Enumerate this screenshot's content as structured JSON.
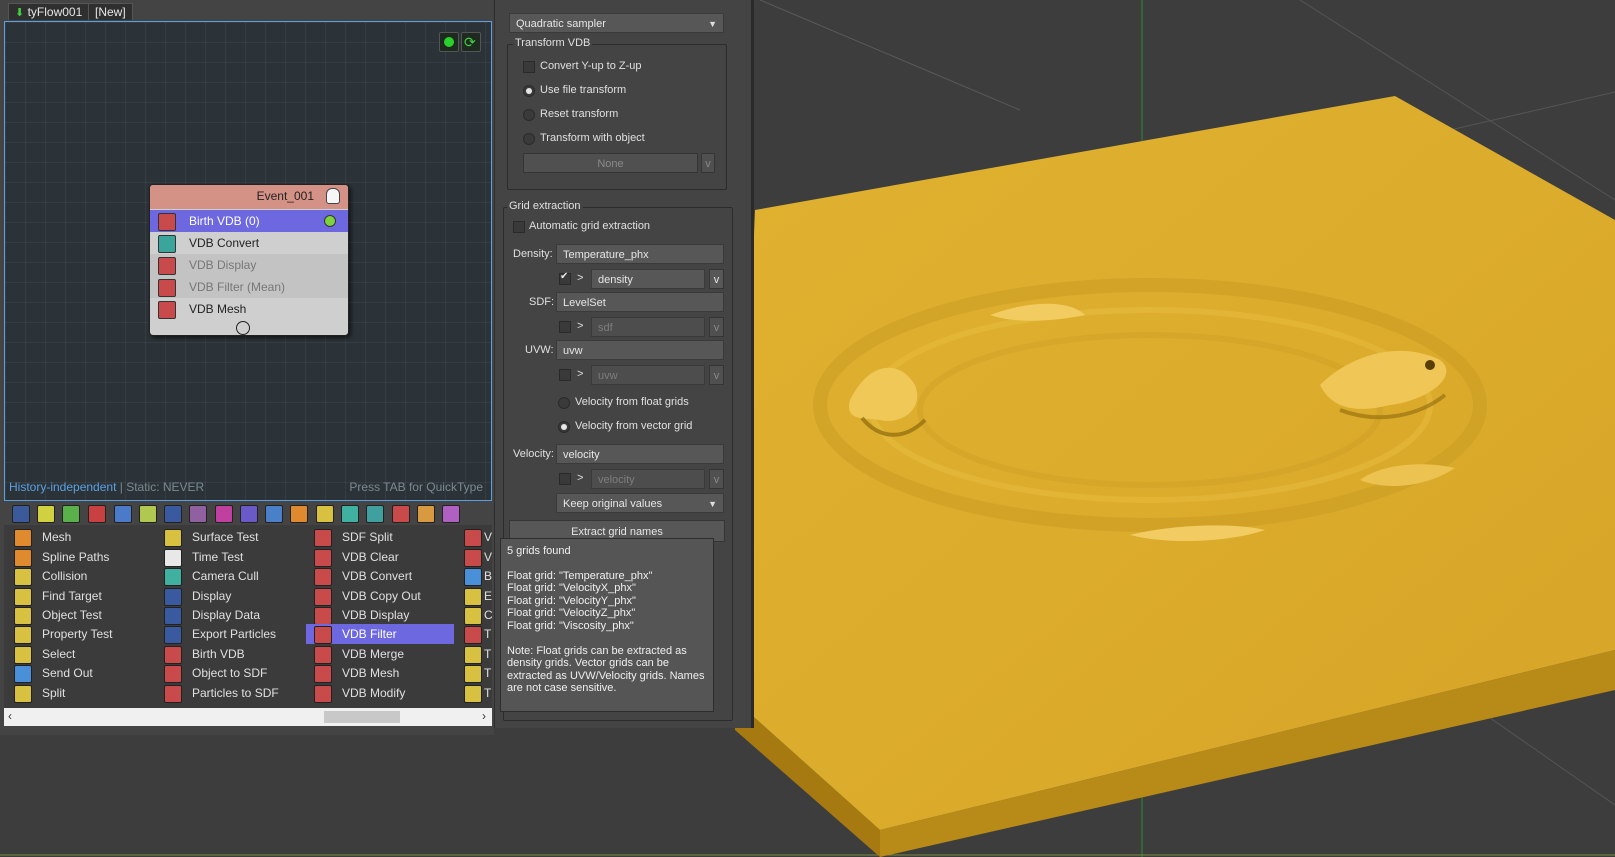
{
  "tabs": [
    {
      "label": "tyFlow001"
    },
    {
      "label": "[New]"
    }
  ],
  "graph": {
    "status_left_link": "History-independent",
    "status_left_rest": " | Static: NEVER",
    "status_right": "Press TAB for QuickType"
  },
  "event": {
    "title": "Event_001",
    "operators": [
      {
        "label": "Birth VDB (0)",
        "state": "selected"
      },
      {
        "label": "VDB Convert",
        "state": "normal"
      },
      {
        "label": "VDB Display",
        "state": "disabled"
      },
      {
        "label": "VDB Filter (Mean)",
        "state": "disabled"
      },
      {
        "label": "VDB Mesh",
        "state": "normal"
      }
    ]
  },
  "operator_list": {
    "col1": [
      "Mesh",
      "Spline Paths",
      "Collision",
      "Find Target",
      "Object Test",
      "Property Test",
      "Select",
      "Send Out",
      "Split"
    ],
    "col2": [
      "Surface Test",
      "Time Test",
      "Camera Cull",
      "Display",
      "Display Data",
      "Export Particles",
      "Birth VDB",
      "Object to SDF",
      "Particles to SDF"
    ],
    "col3": [
      "SDF Split",
      "VDB Clear",
      "VDB Convert",
      "VDB Copy Out",
      "VDB Display",
      "VDB Filter",
      "VDB Merge",
      "VDB Mesh",
      "VDB Modify"
    ],
    "col4": [
      "V",
      "V",
      "B",
      "E",
      "C",
      "T",
      "T",
      "T",
      "T"
    ],
    "selected": "VDB Filter"
  },
  "props": {
    "sampler": "Quadratic sampler",
    "transform_title": "Transform VDB",
    "convert_yup": "Convert Y-up to Z-up",
    "use_file_transform": "Use file transform",
    "reset_transform": "Reset transform",
    "transform_with_object": "Transform with object",
    "none_button": "None",
    "v": "v",
    "grid_title": "Grid extraction",
    "auto_grid": "Automatic grid extraction",
    "density_label": "Density:",
    "density_value": "Temperature_phx",
    "density_sub": "density",
    "sdf_label": "SDF:",
    "sdf_value": "LevelSet",
    "sdf_sub": "sdf",
    "uvw_label": "UVW:",
    "uvw_value": "uvw",
    "uvw_sub": "uvw",
    "vel_float": "Velocity from float grids",
    "vel_vector": "Velocity from vector grid",
    "velocity_label": "Velocity:",
    "velocity_value": "velocity",
    "velocity_sub": "velocity",
    "keep_values": "Keep original values",
    "extract_button": "Extract grid names",
    "arrow": ">"
  },
  "info": {
    "count": "5 grids found",
    "grids": [
      "Float grid: \"Temperature_phx\"",
      "Float grid: \"VelocityX_phx\"",
      "Float grid: \"VelocityY_phx\"",
      "Float grid: \"VelocityZ_phx\"",
      "Float grid: \"Viscosity_phx\""
    ],
    "note": "Note: Float grids can be extracted as density grids. Vector grids can be extracted as UVW/Velocity grids. Names are not case sensitive."
  },
  "colors": {
    "selection": "#6e68e0",
    "event_header": "#d49185",
    "mesh_yellow": "#e0b02e",
    "viewport_bg": "#3d3d3d",
    "link_blue": "#5aa0e0"
  }
}
